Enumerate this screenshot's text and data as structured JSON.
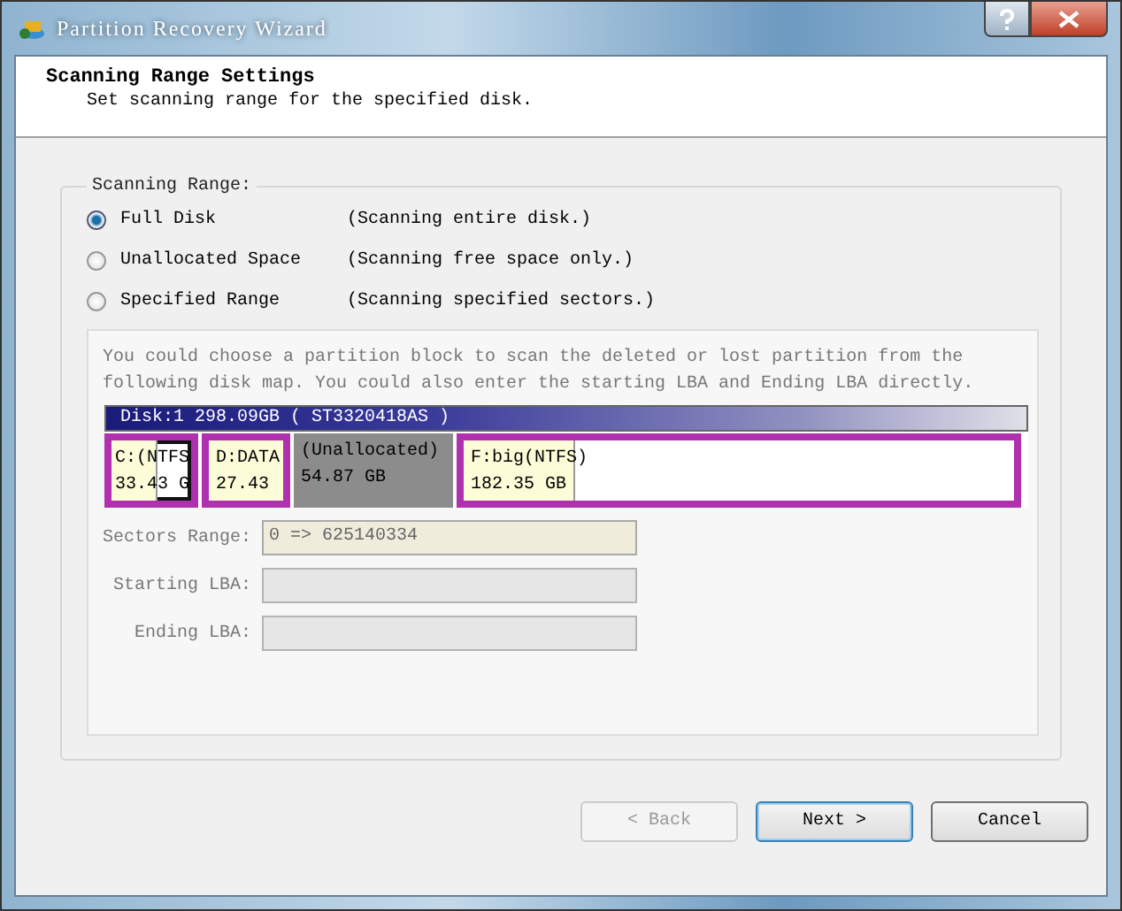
{
  "window": {
    "title": "Partition Recovery Wizard"
  },
  "header": {
    "title": "Scanning Range Settings",
    "subtitle": "Set scanning range for the specified disk."
  },
  "group": {
    "label": "Scanning Range:",
    "options": [
      {
        "label": "Full Disk",
        "description": "(Scanning entire disk.)",
        "selected": true
      },
      {
        "label": "Unallocated Space",
        "description": "(Scanning free space only.)",
        "selected": false
      },
      {
        "label": "Specified Range",
        "description": "(Scanning specified sectors.)",
        "selected": false
      }
    ],
    "hint": "You could choose a partition block to scan the deleted or lost partition from the following disk map. You could also enter the starting LBA and Ending LBA directly.",
    "disk": {
      "title": "Disk:1 298.09GB   ( ST3320418AS )",
      "partitions": [
        {
          "kind": "partition",
          "name": "C:(NTFS",
          "size": "33.43 G",
          "level": 0.55,
          "selected": true
        },
        {
          "kind": "partition",
          "name": "D:DATA",
          "size": "27.43",
          "level": 1,
          "selected": false
        },
        {
          "kind": "unallocated",
          "name": "(Unallocated)",
          "size": "54.87 GB",
          "selected": false
        },
        {
          "kind": "partition",
          "name": "F:big(NTFS)",
          "size": "182.35 GB",
          "level": 0.2,
          "selected": false
        }
      ]
    },
    "fields": [
      {
        "label": "Sectors Range:",
        "value": "0 => 625140334"
      },
      {
        "label": "Starting LBA:"
      },
      {
        "label": "Ending LBA:"
      }
    ]
  },
  "buttons": [
    {
      "label": "< Back",
      "disabled": true,
      "default": false
    },
    {
      "label": "Next >",
      "disabled": false,
      "default": true
    },
    {
      "label": "Cancel",
      "disabled": false,
      "default": false
    }
  ]
}
